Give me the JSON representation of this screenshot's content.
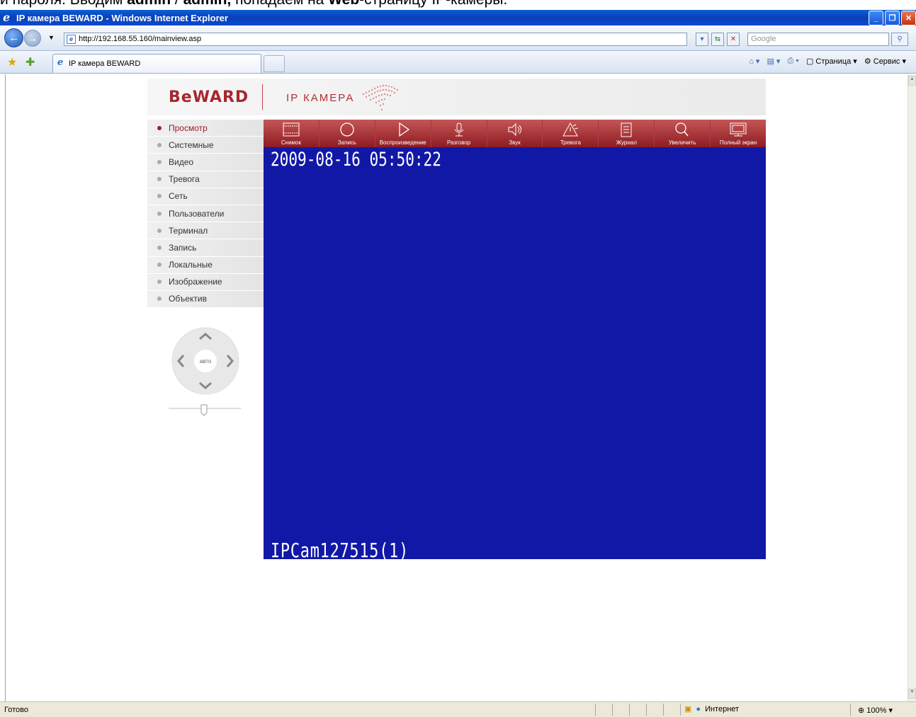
{
  "doc_caption": {
    "pre": "и пароля. Вводим ",
    "b1": "admin",
    "mid1": " / ",
    "b2": "admin,",
    "mid2": " попадаем на ",
    "b3": "Web",
    "post": "-страницу IP-камеры."
  },
  "window": {
    "title": "IP камера BEWARD - Windows Internet Explorer"
  },
  "address": {
    "url": "http://192.168.55.160/mainview.asp",
    "search_placeholder": "Google"
  },
  "tabs": [
    {
      "label": "IP камера BEWARD"
    }
  ],
  "command_bar": {
    "page": "Страница",
    "tools": "Сервис"
  },
  "status": {
    "text": "Готово",
    "zone": "Интернет",
    "zoom": "100%"
  },
  "header": {
    "logo": "BeWARD",
    "product": "IP КАМЕРА"
  },
  "menu": [
    {
      "label": "Просмотр",
      "active": true
    },
    {
      "label": "Системные"
    },
    {
      "label": "Видео"
    },
    {
      "label": "Тревога"
    },
    {
      "label": "Сеть"
    },
    {
      "label": "Пользователи"
    },
    {
      "label": "Терминал"
    },
    {
      "label": "Запись"
    },
    {
      "label": "Локальные"
    },
    {
      "label": "Изображение"
    },
    {
      "label": "Объектив"
    }
  ],
  "ptz": {
    "center": "авто"
  },
  "toolbar": [
    {
      "label": "Снимок",
      "icon": "film-icon"
    },
    {
      "label": "Запись",
      "icon": "record-icon"
    },
    {
      "label": "Воспроизведение",
      "icon": "play-icon"
    },
    {
      "label": "Разговор",
      "icon": "microphone-icon"
    },
    {
      "label": "Звук",
      "icon": "speaker-icon"
    },
    {
      "label": "Тревога",
      "icon": "alarm-icon"
    },
    {
      "label": "Журнал",
      "icon": "log-icon"
    },
    {
      "label": "Увеличить",
      "icon": "zoom-icon"
    },
    {
      "label": "Полный экран",
      "icon": "fullscreen-icon"
    }
  ],
  "video": {
    "timestamp": "2009-08-16 05:50:22",
    "camera_name": "IPCam127515(1)",
    "background": "#1218a6"
  },
  "colors": {
    "brand": "#a8262e",
    "toolbar": "#a83b40"
  }
}
